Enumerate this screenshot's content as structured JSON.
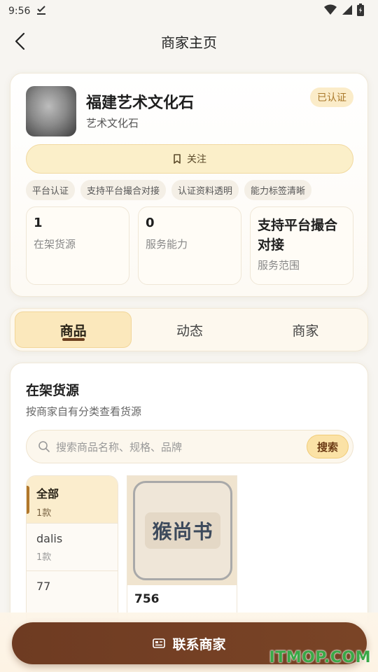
{
  "statusbar": {
    "time": "9:56"
  },
  "navbar": {
    "title": "商家主页"
  },
  "profile": {
    "shop_name": "福建艺术文化石",
    "shop_category": "艺术文化石",
    "verified_label": "已认证",
    "follow_label": "关注",
    "tags": [
      "平台认证",
      "支持平台撮合对接",
      "认证资料透明",
      "能力标签清晰"
    ],
    "stats": [
      {
        "value": "1",
        "label": "在架货源"
      },
      {
        "value": "0",
        "label": "服务能力"
      },
      {
        "value": "支持平台撮合对接",
        "label": "服务范围"
      }
    ]
  },
  "tabs": [
    {
      "label": "商品",
      "active": true
    },
    {
      "label": "动态",
      "active": false
    },
    {
      "label": "商家",
      "active": false
    }
  ],
  "goods": {
    "title": "在架货源",
    "subtitle": "按商家自有分类查看货源",
    "search_placeholder": "搜索商品名称、规格、品牌",
    "search_button": "搜索",
    "categories": [
      {
        "name": "全部",
        "count": "1款",
        "active": true
      },
      {
        "name": "dalis",
        "count": "1款",
        "active": false
      },
      {
        "name": "77",
        "count": "",
        "active": false
      }
    ],
    "products": [
      {
        "name": "756",
        "image_text": "猴尚书"
      }
    ]
  },
  "bottom": {
    "contact_label": "联系商家"
  },
  "watermark": "ITMOP.COM",
  "colors": {
    "accent_brown": "#6e3b22",
    "accent_gold": "#fbe8bc",
    "badge_text": "#a9782a"
  }
}
